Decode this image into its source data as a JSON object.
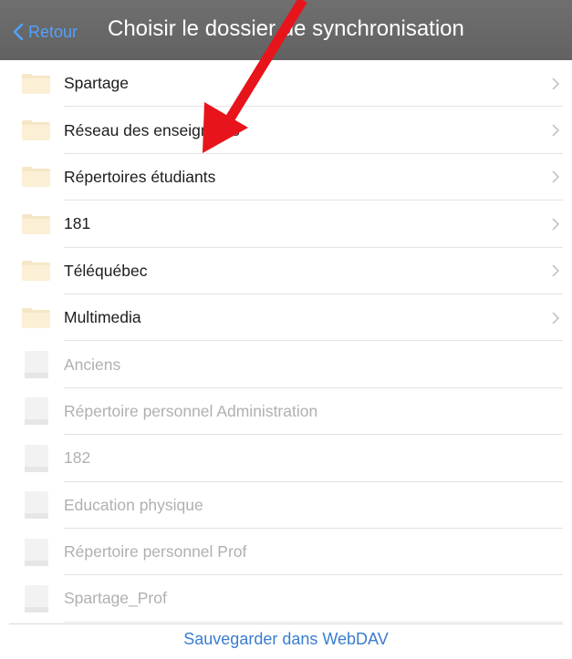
{
  "navbar": {
    "back_label": "Retour",
    "title": "Choisir le dossier de synchronisation",
    "back_color": "#4fa3ff",
    "background": "#666666"
  },
  "folders": [
    {
      "label": "Spartage",
      "icon": "folder-icon",
      "has_chevron": true
    },
    {
      "label": "Réseau des enseignants",
      "icon": "folder-icon",
      "has_chevron": true
    },
    {
      "label": "Répertoires étudiants",
      "icon": "folder-icon",
      "has_chevron": true
    },
    {
      "label": "181",
      "icon": "folder-icon",
      "has_chevron": true
    },
    {
      "label": "Téléquébec",
      "icon": "folder-icon",
      "has_chevron": true
    },
    {
      "label": "Multimedia",
      "icon": "folder-icon",
      "has_chevron": true
    }
  ],
  "files": [
    {
      "label": "Anciens",
      "icon": "file-icon",
      "disabled": true
    },
    {
      "label": "Répertoire personnel Administration",
      "icon": "file-icon",
      "disabled": true
    },
    {
      "label": "182",
      "icon": "file-icon",
      "disabled": true
    },
    {
      "label": "Education physique",
      "icon": "file-icon",
      "disabled": true
    },
    {
      "label": "Répertoire personnel Prof",
      "icon": "file-icon",
      "disabled": true
    },
    {
      "label": "Spartage_Prof",
      "icon": "file-icon",
      "disabled": true
    }
  ],
  "footer": {
    "save_label": "Sauvegarder dans WebDAV",
    "color": "#3a7dcf"
  },
  "annotation": {
    "arrow_color": "#e8141b",
    "arrow_icon": "red-arrow-icon"
  }
}
